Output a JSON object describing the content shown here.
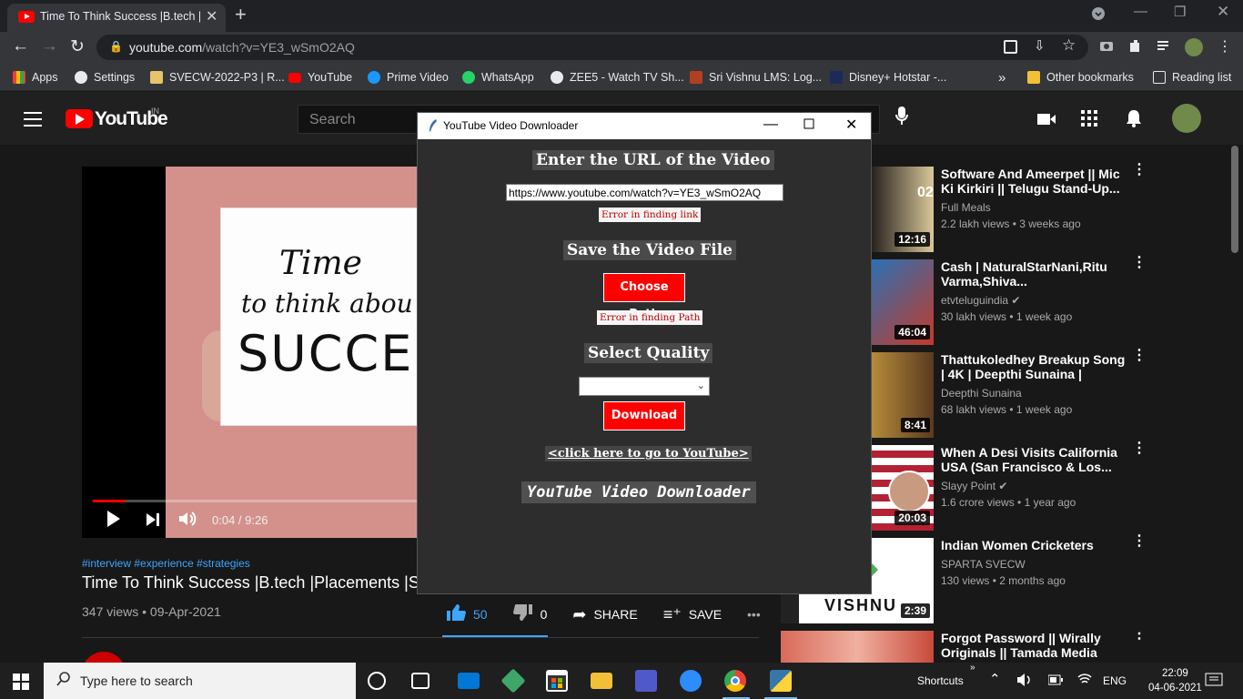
{
  "browser": {
    "tab_title": "Time To Think Success |B.tech |Pla",
    "new_tab": "+",
    "close_tab": "✕",
    "url_host": "youtube.com",
    "url_path": "/watch?v=YE3_wSmO2AQ",
    "bookmarks": [
      "Apps",
      "Settings",
      "SVECW-2022-P3 | R...",
      "YouTube",
      "Prime Video",
      "WhatsApp",
      "ZEE5 - Watch TV Sh...",
      "Sri Vishnu LMS: Log...",
      "Disney+ Hotstar -..."
    ],
    "bookmarks_more": "»",
    "other_bookmarks": "Other bookmarks",
    "reading_list": "Reading list"
  },
  "youtube": {
    "wordmark": "YouTube",
    "region": "IN",
    "search_placeholder": "Search",
    "player": {
      "card_line1": "Time",
      "card_line2": "to think abou",
      "card_line3": "SUCCES",
      "time": "0:04 / 9:26",
      "progress_fraction": 0.007
    },
    "video": {
      "tags": "#interview #experience #strategies",
      "title": "Time To Think Success |B.tech |Placements |S",
      "meta": "347 views • 09-Apr-2021",
      "likes": "50",
      "dislikes": "0",
      "share": "SHARE",
      "save": "SAVE",
      "more": "•••"
    },
    "recommendations": [
      {
        "title": "Software And Ameerpet || Mic Ki Kirkiri || Telugu Stand-Up...",
        "channel": "Full Meals",
        "meta": "2.2 lakh views • 3 weeks ago",
        "duration": "12:16",
        "thumb_color": "#3b2a1a"
      },
      {
        "title": "Cash | NaturalStarNani,Ritu Varma,Shiva...",
        "channel": "etvteluguindia ✔",
        "meta": "30 lakh views • 1 week ago",
        "duration": "46:04",
        "thumb_color": "#7a3a2a"
      },
      {
        "title": "Thattukoledhey Breakup Song | 4K | Deepthi Sunaina | Vinay...",
        "channel": "Deepthi Sunaina",
        "meta": "68 lakh views • 1 week ago",
        "duration": "8:41",
        "thumb_color": "#c9a04a"
      },
      {
        "title": "When A Desi Visits California USA (San Francisco & Los...",
        "channel": "Slayy Point ✔",
        "meta": "1.6 crore views • 1 year ago",
        "duration": "20:03",
        "thumb_color": "#4a5a8a"
      },
      {
        "title": "Indian Women Cricketers",
        "channel": "SPARTA SVECW",
        "meta": "130 views • 2 months ago",
        "duration": "2:39",
        "thumb_color": "#f2f2f2",
        "thumb_text": "VISHNU"
      },
      {
        "title": "Forgot Password || Wirally Originals || Tamada Media",
        "channel": "",
        "meta": "",
        "duration": "",
        "thumb_color": "#d86a5a"
      }
    ]
  },
  "dialog": {
    "title": "YouTube Video Downloader",
    "heading_url": "Enter the URL of the Video",
    "url_value": "https://www.youtube.com/watch?v=YE3_wSmO2AQ",
    "err_link": "Error in finding link",
    "heading_save": "Save the Video File",
    "choose_path": "Choose Path",
    "err_path": "Error in finding Path",
    "heading_quality": "Select Quality",
    "quality_value": "",
    "download": "Download",
    "yt_link": "<click here to go to YouTube>",
    "footer": "YouTube Video Downloader"
  },
  "taskbar": {
    "search_placeholder": "Type here to search",
    "shortcuts": "Shortcuts",
    "lang": "ENG",
    "time": "22:09",
    "date": "04-06-2021"
  },
  "colors": {
    "accent_red": "#ff0000",
    "link_blue": "#3ea6ff",
    "error_red": "#c00000"
  }
}
